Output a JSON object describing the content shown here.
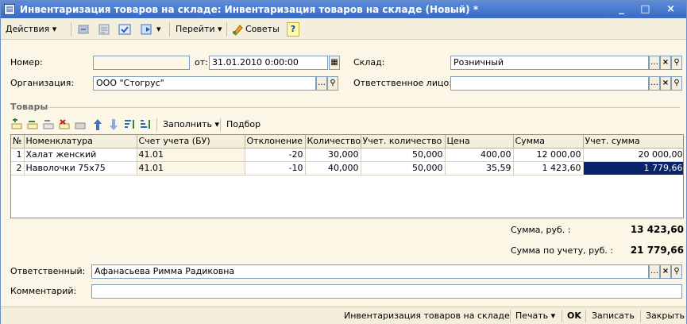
{
  "window": {
    "title": "Инвентаризация товаров на складе: Инвентаризация товаров на складе (Новый) *",
    "controls": "_ □ ×"
  },
  "toolbar": {
    "actions_label": "Действия ▾",
    "goto_label": "Перейти ▾",
    "tips_label": "Советы",
    "help_label": "?"
  },
  "header": {
    "number_label": "Номер:",
    "number_value": "",
    "date_label": "от:",
    "date_value": "31.01.2010  0:00:00",
    "warehouse_label": "Склад:",
    "warehouse_value": "Розничный",
    "org_label": "Организация:",
    "org_value": "ООО \"Стогрус\"",
    "resp_person_label": "Ответственное лицо:",
    "resp_person_value": ""
  },
  "goods": {
    "section_title": "Товары",
    "fill_label": "Заполнить ▾",
    "select_label": "Подбор",
    "columns": [
      "№",
      "Номенклатура",
      "Счет учета (БУ)",
      "Отклонение",
      "Количество",
      "Учет. количество",
      "Цена",
      "Сумма",
      "Учет. сумма"
    ],
    "rows": [
      {
        "n": "1",
        "item": "Халат женский",
        "account": "41.01",
        "deviation": "-20",
        "qty": "30,000",
        "acc_qty": "50,000",
        "price": "400,00",
        "sum": "12 000,00",
        "acc_sum": "20 000,00"
      },
      {
        "n": "2",
        "item": "Наволочки 75х75",
        "account": "41.01",
        "deviation": "-10",
        "qty": "40,000",
        "acc_qty": "50,000",
        "price": "35,59",
        "sum": "1 423,60",
        "acc_sum": "1 779,66"
      }
    ]
  },
  "totals": {
    "sum_label": "Сумма, руб. :",
    "sum_value": "13 423,60",
    "acc_sum_label": "Сумма по учету, руб. :",
    "acc_sum_value": "21 779,66"
  },
  "footer": {
    "responsible_label": "Ответственный:",
    "responsible_value": "Афанасьева Римма Радиковна",
    "comment_label": "Комментарий:",
    "comment_value": ""
  },
  "bottombar": {
    "doc_label": "Инвентаризация товаров на складе",
    "print_label": "Печать ▾",
    "ok_label": "OK",
    "save_label": "Записать",
    "close_label": "Закрыть"
  },
  "colors": {
    "title_bg": "#3a6bc4",
    "form_bg": "#fbf6e5",
    "selection": "#0a246a"
  }
}
